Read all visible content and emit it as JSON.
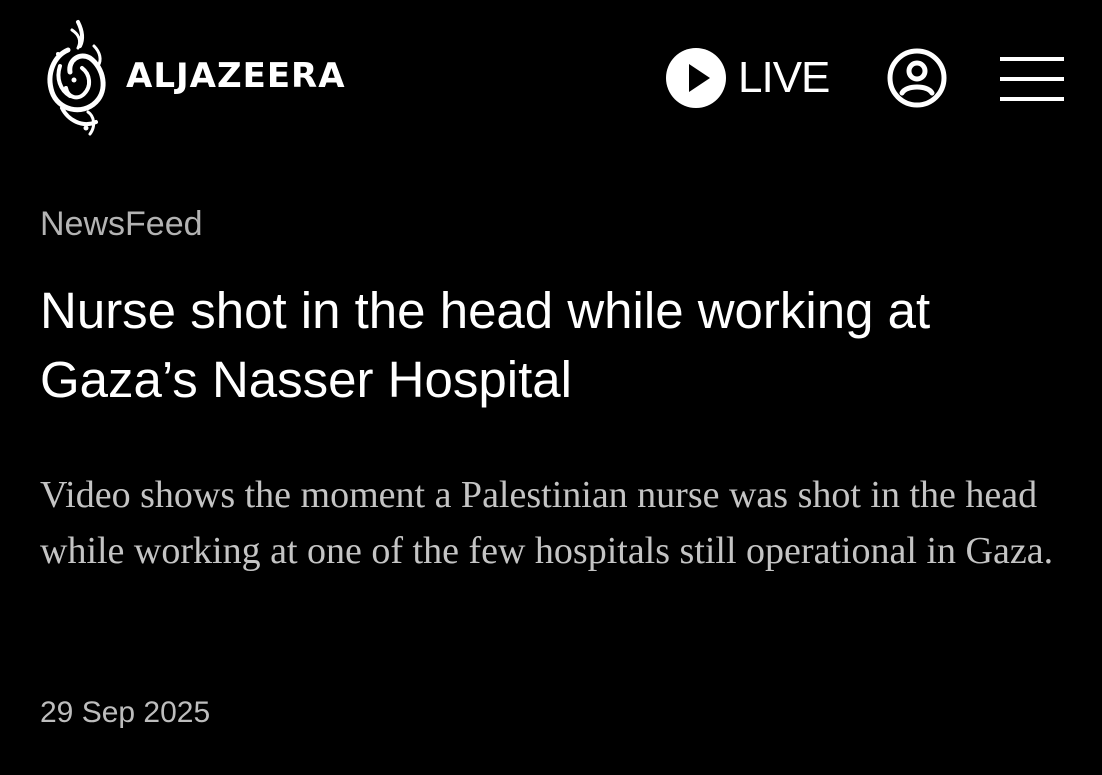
{
  "header": {
    "brand": "ALJAZEERA",
    "logo_icon": "aljazeera-calligraphy-logo",
    "live_label": "LIVE",
    "live_icon": "play-icon",
    "account_icon": "user-account-icon",
    "menu_icon": "hamburger-menu-icon"
  },
  "article": {
    "category": "NewsFeed",
    "headline": "Nurse shot in the head while working at Gaza’s Nasser Hospital",
    "summary": "Video shows the moment a Palestinian nurse was shot in the head while working at one of the few hospitals still operational in Gaza.",
    "date": "29 Sep 2025"
  },
  "colors": {
    "background": "#000000",
    "text_primary": "#ffffff",
    "text_secondary": "#c4c4c4",
    "text_muted": "#b3b3b3"
  }
}
